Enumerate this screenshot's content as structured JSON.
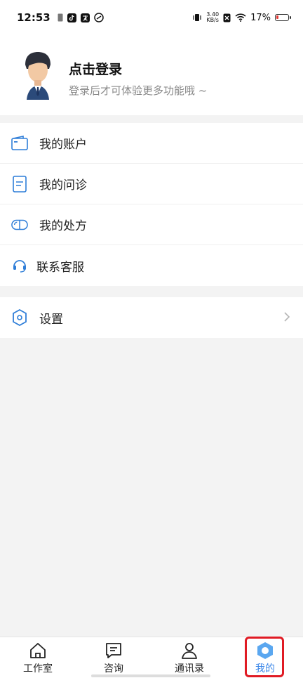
{
  "status": {
    "time": "12:53",
    "net_speed_value": "3.40",
    "net_speed_unit": "KB/s",
    "battery": "17%"
  },
  "profile": {
    "title": "点击登录",
    "subtitle": "登录后才可体验更多功能哦 ~"
  },
  "menu": [
    {
      "label": "我的账户",
      "icon": "wallet-icon"
    },
    {
      "label": "我的问诊",
      "icon": "document-icon"
    },
    {
      "label": "我的处方",
      "icon": "pill-icon"
    },
    {
      "label": "联系客服",
      "icon": "headset-icon"
    }
  ],
  "settings": {
    "label": "设置",
    "icon": "hexagon-settings-icon"
  },
  "tabs": [
    {
      "label": "工作室",
      "icon": "home-icon"
    },
    {
      "label": "咨询",
      "icon": "chat-icon"
    },
    {
      "label": "通讯录",
      "icon": "contacts-icon"
    },
    {
      "label": "我的",
      "icon": "profile-hexagon-icon"
    }
  ],
  "colors": {
    "accent": "#3a86e8",
    "highlight": "#e01b24"
  }
}
